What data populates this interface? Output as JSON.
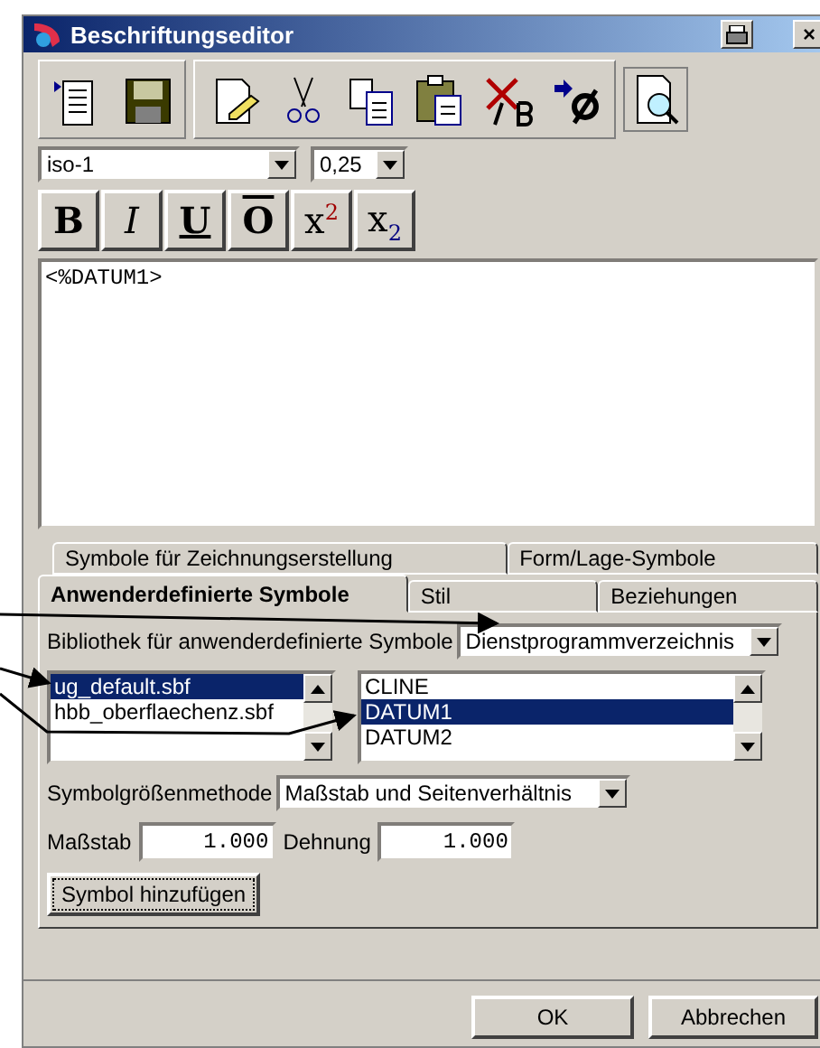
{
  "window": {
    "title": "Beschriftungseditor",
    "close": "×"
  },
  "toolbar": {
    "font": {
      "value": "iso-1"
    },
    "width": {
      "value": "0,25"
    }
  },
  "format_buttons": [
    {
      "kind": "bold",
      "label": "B"
    },
    {
      "kind": "italic",
      "label": "I"
    },
    {
      "kind": "underline",
      "label": "U"
    },
    {
      "kind": "overline",
      "label": "O"
    },
    {
      "kind": "superscript",
      "label": "x$^{2}$"
    },
    {
      "kind": "subscript",
      "label": "x$_{2}$"
    }
  ],
  "editor": {
    "value": "<%DATUM1>"
  },
  "tabs": [
    [
      {
        "label": "Symbole für Zeichnungserstellung",
        "selected": false
      },
      {
        "label": "Form/Lage-Symbole",
        "selected": false
      }
    ],
    [
      {
        "label": "Anwenderdefinierte Symbole",
        "selected": true
      },
      {
        "label": "Stil",
        "selected": false
      },
      {
        "label": "Beziehungen",
        "selected": false
      }
    ]
  ],
  "library": {
    "label": "Bibliothek für anwenderdefinierte Symbole",
    "value": "Dienstprogrammverzeichnis"
  },
  "files": [
    {
      "label": "ug_default.sbf",
      "selected": true
    },
    {
      "label": "hbb_oberflaechenz.sbf",
      "selected": false
    }
  ],
  "symbols": [
    {
      "label": "CLINE",
      "selected": false
    },
    {
      "label": "DATUM1",
      "selected": true
    },
    {
      "label": "DATUM2",
      "selected": false
    }
  ],
  "size_method": {
    "label": "Symbolgrößenmethode",
    "value": "Maßstab und Seitenverhältnis"
  },
  "scale": {
    "label": "Maßstab",
    "value": "1.000"
  },
  "stretch": {
    "label": "Dehnung",
    "value": "1.000"
  },
  "add_button": "Symbol hinzufügen",
  "buttons": [
    "OK",
    "Abbrechen"
  ]
}
